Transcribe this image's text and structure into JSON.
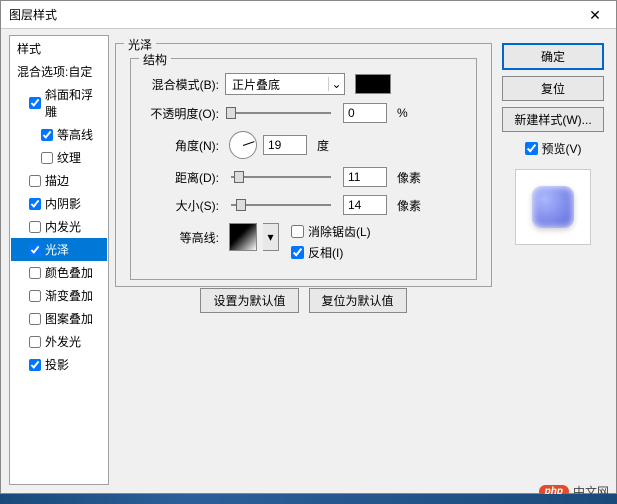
{
  "window": {
    "title": "图层样式"
  },
  "buttons": {
    "ok": "确定",
    "reset": "复位",
    "new_style": "新建样式(W)...",
    "preview": "预览(V)",
    "close_x": "✕"
  },
  "left": {
    "header": "样式",
    "blend_options": "混合选项:自定",
    "items": [
      {
        "label": "斜面和浮雕",
        "checked": true,
        "sub": false
      },
      {
        "label": "等高线",
        "checked": true,
        "sub": true
      },
      {
        "label": "纹理",
        "checked": false,
        "sub": true
      },
      {
        "label": "描边",
        "checked": false,
        "sub": false
      },
      {
        "label": "内阴影",
        "checked": true,
        "sub": false
      },
      {
        "label": "内发光",
        "checked": false,
        "sub": false
      },
      {
        "label": "光泽",
        "checked": true,
        "sub": false,
        "selected": true
      },
      {
        "label": "颜色叠加",
        "checked": false,
        "sub": false
      },
      {
        "label": "渐变叠加",
        "checked": false,
        "sub": false
      },
      {
        "label": "图案叠加",
        "checked": false,
        "sub": false
      },
      {
        "label": "外发光",
        "checked": false,
        "sub": false
      },
      {
        "label": "投影",
        "checked": true,
        "sub": false
      }
    ]
  },
  "center": {
    "group_title": "光泽",
    "struct_title": "结构",
    "blend_mode_label": "混合模式(B):",
    "blend_mode_value": "正片叠底",
    "opacity_label": "不透明度(O):",
    "opacity_value": "0",
    "opacity_unit": "%",
    "angle_label": "角度(N):",
    "angle_value": "19",
    "angle_unit": "度",
    "distance_label": "距离(D):",
    "distance_value": "11",
    "distance_unit": "像素",
    "size_label": "大小(S):",
    "size_value": "14",
    "size_unit": "像素",
    "gloss_label": "等高线:",
    "anti_alias": "消除锯齿(L)",
    "invert": "反相(I)",
    "anti_alias_checked": false,
    "invert_checked": true,
    "set_default": "设置为默认值",
    "reset_default": "复位为默认值"
  },
  "watermark": {
    "badge": "php",
    "text": "中文网"
  }
}
